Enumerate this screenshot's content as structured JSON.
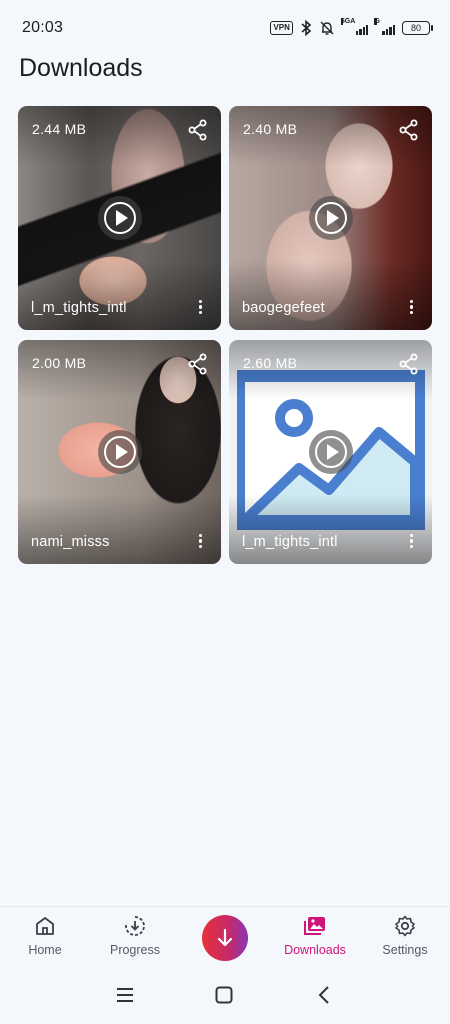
{
  "status_bar": {
    "time": "20:03",
    "vpn": "VPN",
    "network1": "5GA",
    "network2": "G",
    "battery": "80"
  },
  "page": {
    "title": "Downloads"
  },
  "downloads": [
    {
      "size": "2.44 MB",
      "username": "l_m_tights_intl"
    },
    {
      "size": "2.40 MB",
      "username": "baogegefeet"
    },
    {
      "size": "2.00 MB",
      "username": "nami_misss"
    },
    {
      "size": "2.60 MB",
      "username": "l_m_tights_intl"
    }
  ],
  "nav": {
    "home": "Home",
    "progress": "Progress",
    "downloads": "Downloads",
    "settings": "Settings"
  },
  "colors": {
    "accent": "#d0157a",
    "background": "#f4f8fc",
    "placeholder_blue": "#4a7fd0"
  }
}
